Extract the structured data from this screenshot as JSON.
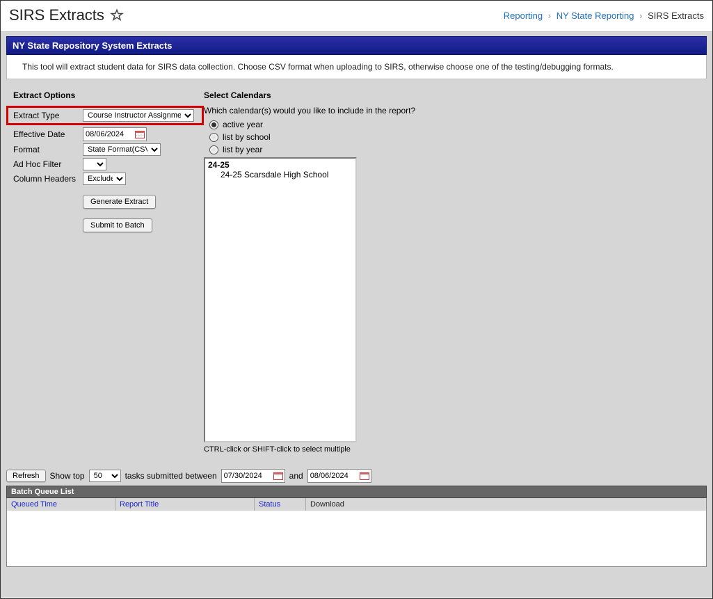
{
  "header": {
    "title": "SIRS Extracts",
    "breadcrumb": {
      "link1": "Reporting",
      "link2": "NY State Reporting",
      "current": "SIRS Extracts"
    }
  },
  "banner_title": "NY State Repository System Extracts",
  "intro_text": "This tool will extract student data for SIRS data collection. Choose CSV format when uploading to SIRS, otherwise choose one of the testing/debugging formats.",
  "extract_options": {
    "heading": "Extract Options",
    "extract_type": {
      "label": "Extract Type",
      "value": "Course Instructor Assignment"
    },
    "effective_date": {
      "label": "Effective Date",
      "value": "08/06/2024"
    },
    "format": {
      "label": "Format",
      "value": "State Format(CSV)"
    },
    "ad_hoc": {
      "label": "Ad Hoc Filter",
      "value": ""
    },
    "column_headers": {
      "label": "Column Headers",
      "value": "Exclude"
    },
    "generate_btn": "Generate Extract",
    "submit_btn": "Submit to Batch"
  },
  "calendars": {
    "heading": "Select Calendars",
    "prompt": "Which calendar(s) would you like to include in the report?",
    "radios": {
      "active": "active year",
      "by_school": "list by school",
      "by_year": "list by year"
    },
    "list_group": "24-25",
    "list_item": "24-25 Scarsdale High School",
    "hint": "CTRL-click or SHIFT-click to select multiple"
  },
  "batch": {
    "refresh": "Refresh",
    "show_top": "Show top",
    "show_top_value": "50",
    "tasks_between": "tasks submitted between",
    "date_from": "07/30/2024",
    "and": "and",
    "date_to": "08/06/2024",
    "queue_title": "Batch Queue List",
    "cols": {
      "queued_time": "Queued Time",
      "report_title": "Report Title",
      "status": "Status",
      "download": "Download"
    }
  }
}
